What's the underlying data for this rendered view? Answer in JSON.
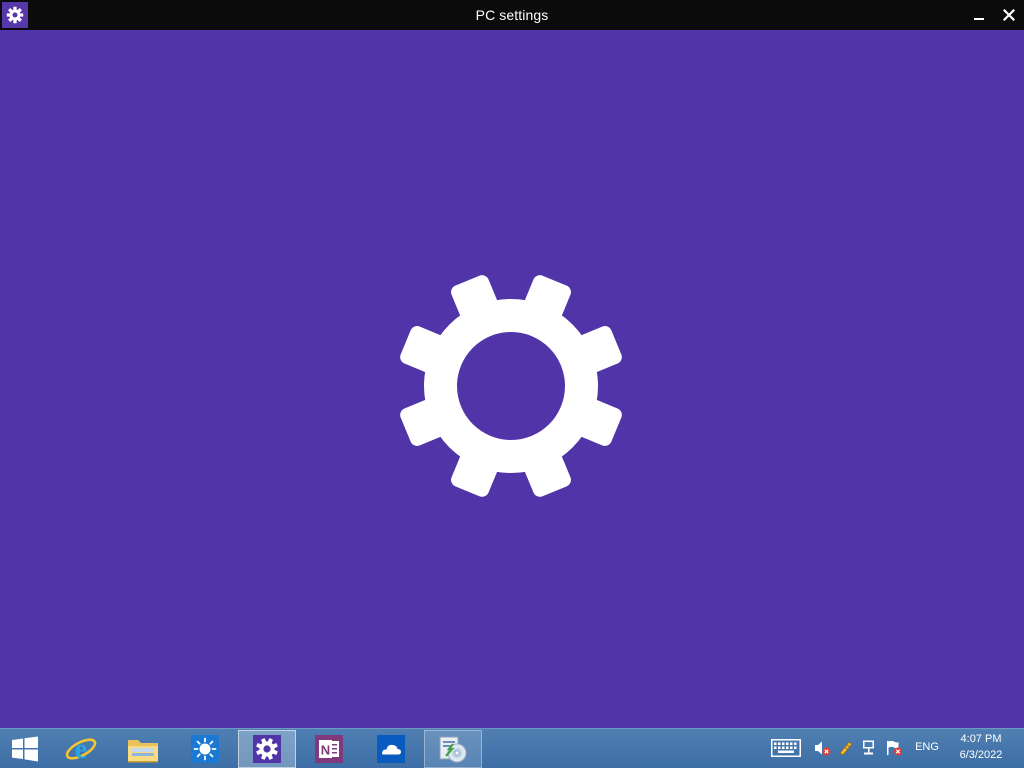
{
  "window": {
    "title": "PC settings",
    "app_icon": "gear-icon",
    "minimize_icon": "minimize-icon",
    "close_icon": "close-icon"
  },
  "splash": {
    "icon": "gear-icon",
    "background_color": "#5034a8",
    "icon_color": "#ffffff"
  },
  "taskbar": {
    "items": [
      {
        "icon": "windows-start-icon",
        "state": "normal"
      },
      {
        "icon": "internet-explorer-icon",
        "state": "normal"
      },
      {
        "icon": "file-explorer-icon",
        "state": "normal"
      },
      {
        "icon": "weather-sun-icon",
        "state": "normal"
      },
      {
        "icon": "settings-gear-icon",
        "state": "active"
      },
      {
        "icon": "onenote-icon",
        "state": "normal"
      },
      {
        "icon": "onedrive-cloud-icon",
        "state": "normal"
      },
      {
        "icon": "installer-disc-icon",
        "state": "running"
      }
    ],
    "tray": {
      "icons": [
        "touch-keyboard-icon",
        "volume-muted-icon",
        "power-icon",
        "network-icon",
        "action-center-flag-icon"
      ],
      "language": "ENG",
      "time": "4:07 PM",
      "date": "6/3/2022"
    }
  },
  "colors": {
    "titlebar": "#0b0b0b",
    "accent": "#5034a8",
    "taskbar": "#4579ae"
  }
}
